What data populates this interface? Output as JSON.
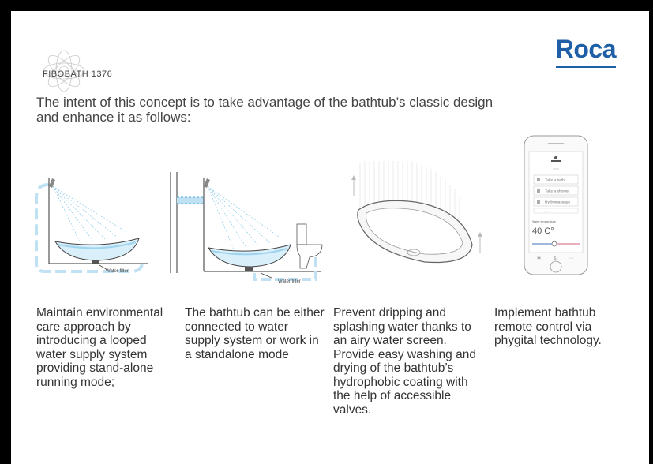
{
  "header": {
    "logo_text": "FIBOBATH 1376",
    "brand": "Roca"
  },
  "intro": "The intent of this concept is to take advantage of the bathtub’s classic design and enhance it as follows:",
  "illustrations": {
    "filter_label_1": "Water filter",
    "filter_label_2": "Water filter"
  },
  "phone": {
    "menu": [
      "Take a bath",
      "Take a shower",
      "Hydromassage",
      "..."
    ],
    "temp_label": "Water temperature",
    "temp_value": "40 C°"
  },
  "columns": [
    {
      "text": "Maintain environmental care approach by introducing a looped water supply system providing stand-alone running mode;"
    },
    {
      "text": "The bathtub can be either connected to water supply system or work in a standalone mode"
    },
    {
      "text": "Prevent dripping and splashing water thanks to an airy water screen. Provide easy washing and drying of the bathtub’s hydrophobic coating with the help of accessible valves."
    },
    {
      "text": "Implement bathtub remote control via phygital technology."
    }
  ],
  "colors": {
    "brand": "#1f5fa8",
    "water": "#bfe3f5",
    "loop": "#a9d7ef"
  }
}
